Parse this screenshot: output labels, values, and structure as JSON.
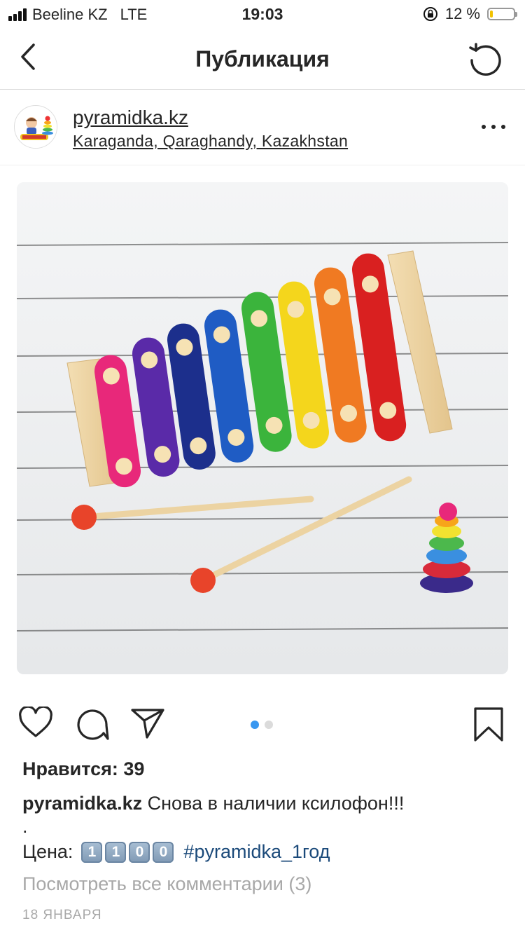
{
  "status_bar": {
    "carrier": "Beeline KZ",
    "network": "LTE",
    "time": "19:03",
    "battery_percent": "12 %",
    "battery_level": 0.12
  },
  "nav": {
    "title": "Публикация",
    "back_icon": "chevron-left-icon",
    "refresh_icon": "refresh-icon"
  },
  "post": {
    "username": "pyramidka.kz",
    "location": "Karaganda, Qaraghandy, Kazakhstan",
    "photo_dots": {
      "count": 2,
      "active_index": 0,
      "active_color": "#3897f0",
      "inactive_color": "#dbdbdb"
    },
    "likes": "Нравится: 39",
    "caption_user": "pyramidka.kz",
    "caption_text": "Снова в наличии ксилофон!!!",
    "caption_dot": ".",
    "price_label": "Цена:",
    "price_digits": [
      "1",
      "1",
      "0",
      "0"
    ],
    "hashtag": "#pyramidka_1год",
    "view_comments": "Посмотреть все комментарии (3)",
    "date": "18 ЯНВАРЯ"
  },
  "colors": {
    "text": "#262626",
    "muted": "#a8a8a8",
    "hashtag": "#1b4a7a",
    "battery": "#f2c200"
  }
}
